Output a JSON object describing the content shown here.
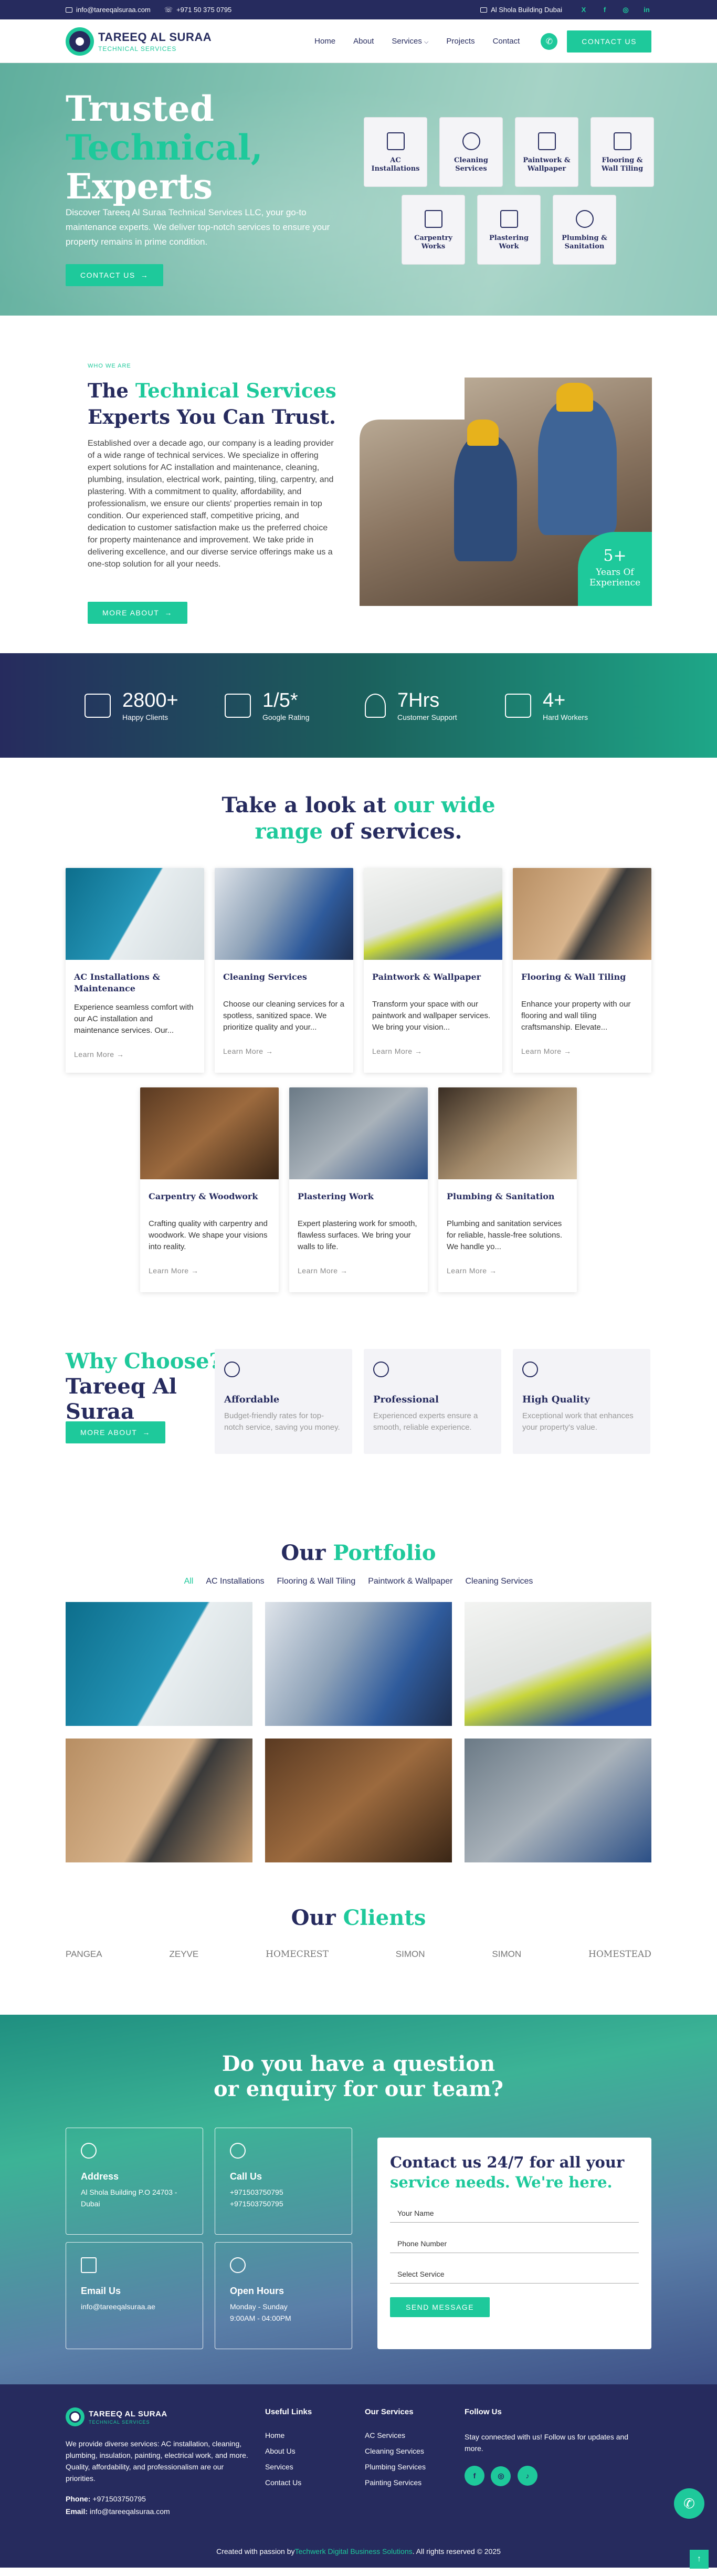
{
  "topbar": {
    "email": "info@tareeqalsuraa.com",
    "phone": "+971 50 375 0795",
    "address": "Al Shola Building Dubai",
    "social": [
      "X",
      "f",
      "◎",
      "in"
    ]
  },
  "header": {
    "logo_title": "TAREEQ AL SURAA",
    "logo_subtitle": "TECHNICAL SERVICES",
    "nav": [
      "Home",
      "About",
      "Services",
      "Projects",
      "Contact"
    ],
    "services_caret": "⌵",
    "cta": "CONTACT US"
  },
  "hero": {
    "line1": "Trusted",
    "line2": "Technical,",
    "line3": "Experts",
    "text": "Discover Tareeq Al Suraa Technical Services LLC, your go-to maintenance experts. We deliver top-notch services to ensure your property remains in prime condition.",
    "button": "CONTACT US",
    "tiles": [
      "AC Installations",
      "Cleaning Services",
      "Paintwork & Wallpaper",
      "Flooring & Wall Tiling",
      "Carpentry Works",
      "Plastering Work",
      "Plumbing & Sanitation"
    ]
  },
  "about": {
    "eyebrow": "WHO WE ARE",
    "title_a": "The ",
    "title_b": "Technical Services",
    "title_c": "Experts You Can Trust.",
    "text": "Established over a decade ago, our company is a leading provider of a wide range of technical services. We specialize in offering expert solutions for AC installation and maintenance, cleaning, plumbing, insulation, electrical work, painting, tiling, carpentry, and plastering. With a commitment to quality, affordability, and professionalism, we ensure our clients' properties remain in top condition. Our experienced staff, competitive pricing, and dedication to customer satisfaction make us the preferred choice for property maintenance and improvement. We take pride in delivering excellence, and our diverse service offerings make us a one-stop solution for all your needs.",
    "button": "MORE ABOUT",
    "years_num": "5+",
    "years_label": "Years Of Experience"
  },
  "stats": [
    {
      "num": "2800+",
      "label": "Happy Clients"
    },
    {
      "num": "1/5*",
      "label": "Google Rating"
    },
    {
      "num": "7Hrs",
      "label": "Customer Support"
    },
    {
      "num": "4+",
      "label": "Hard Workers"
    }
  ],
  "services": {
    "title_a": "Take a look at ",
    "title_b": "our wide",
    "title_c": "range",
    "title_d": " of services.",
    "learn_more": "Learn More →",
    "cards": [
      {
        "title": "AC Installations & Maintenance",
        "desc": "Experience seamless comfort with our AC installation and maintenance services. Our..."
      },
      {
        "title": "Cleaning Services",
        "desc": "Choose our cleaning services for a spotless, sanitized space. We prioritize quality and your..."
      },
      {
        "title": "Paintwork & Wallpaper",
        "desc": "Transform your space with our paintwork and wallpaper services. We bring your vision..."
      },
      {
        "title": "Flooring & Wall Tiling",
        "desc": "Enhance your property with our flooring and wall tiling craftsmanship. Elevate..."
      },
      {
        "title": "Carpentry & Woodwork",
        "desc": "Crafting quality with carpentry and woodwork. We shape your visions into reality."
      },
      {
        "title": "Plastering Work",
        "desc": "Expert plastering work for smooth, flawless surfaces. We bring your walls to life."
      },
      {
        "title": "Plumbing & Sanitation",
        "desc": "Plumbing and sanitation services for reliable, hassle-free solutions. We handle yo..."
      }
    ]
  },
  "why": {
    "line1": "Why Choose?",
    "line2": "Tareeq Al",
    "line3": "Suraa",
    "button": "MORE ABOUT",
    "cards": [
      {
        "title": "Affordable",
        "desc": "Budget-friendly rates for top-notch service, saving you money."
      },
      {
        "title": "Professional",
        "desc": "Experienced experts ensure a smooth, reliable experience."
      },
      {
        "title": "High Quality",
        "desc": "Exceptional work that enhances your property's value."
      }
    ]
  },
  "portfolio": {
    "title_a": "Our ",
    "title_b": "Portfolio",
    "tabs": [
      "All",
      "AC Installations",
      "Flooring & Wall Tiling",
      "Paintwork & Wallpaper",
      "Cleaning Services"
    ]
  },
  "clients": {
    "title_a": "Our ",
    "title_b": "Clients",
    "logos": [
      "PANGEA",
      "ZEYVE",
      "HOMECREST",
      "SIMON",
      "SIMON",
      "HOMESTEAD"
    ]
  },
  "contact": {
    "title_a": "Do you have a question",
    "title_b": "or enquiry for our team?",
    "boxes": [
      {
        "title": "Address",
        "lines": [
          "Al Shola Building P.O 24703 -",
          "Dubai"
        ]
      },
      {
        "title": "Call Us",
        "lines": [
          "+971503750795",
          "+971503750795"
        ]
      },
      {
        "title": "Email Us",
        "lines": [
          "info@tareeqalsuraa.ae"
        ]
      },
      {
        "title": "Open Hours",
        "lines": [
          "Monday - Sunday",
          "9:00AM - 04:00PM"
        ]
      }
    ],
    "form_title_a": "Contact us 24/7 for all your",
    "form_title_b": "service needs. We're here.",
    "fields": [
      "Your Name",
      "Phone Number",
      "Select Service"
    ],
    "submit": "SEND MESSAGE"
  },
  "footer": {
    "about": "We provide diverse services: AC installation, cleaning, plumbing, insulation, painting, electrical work, and more. Quality, affordability, and professionalism are our priorities.",
    "phone_label": "Phone:",
    "phone": "+971503750795",
    "email_label": "Email:",
    "email": "info@tareeqalsuraa.com",
    "links_title": "Useful Links",
    "links": [
      "Home",
      "About Us",
      "Services",
      "Contact Us"
    ],
    "services_title": "Our Services",
    "services": [
      "AC Services",
      "Cleaning Services",
      "Plumbing Services",
      "Painting Services"
    ],
    "follow_title": "Follow Us",
    "follow_text": "Stay connected with us! Follow us for updates and more.",
    "social": [
      "f",
      "◎",
      "♪"
    ],
    "copy_a": "Created with passion by ",
    "copy_b": "Techwerk Digital Business Solutions",
    "copy_c": ". All rights reserved © 2025"
  }
}
